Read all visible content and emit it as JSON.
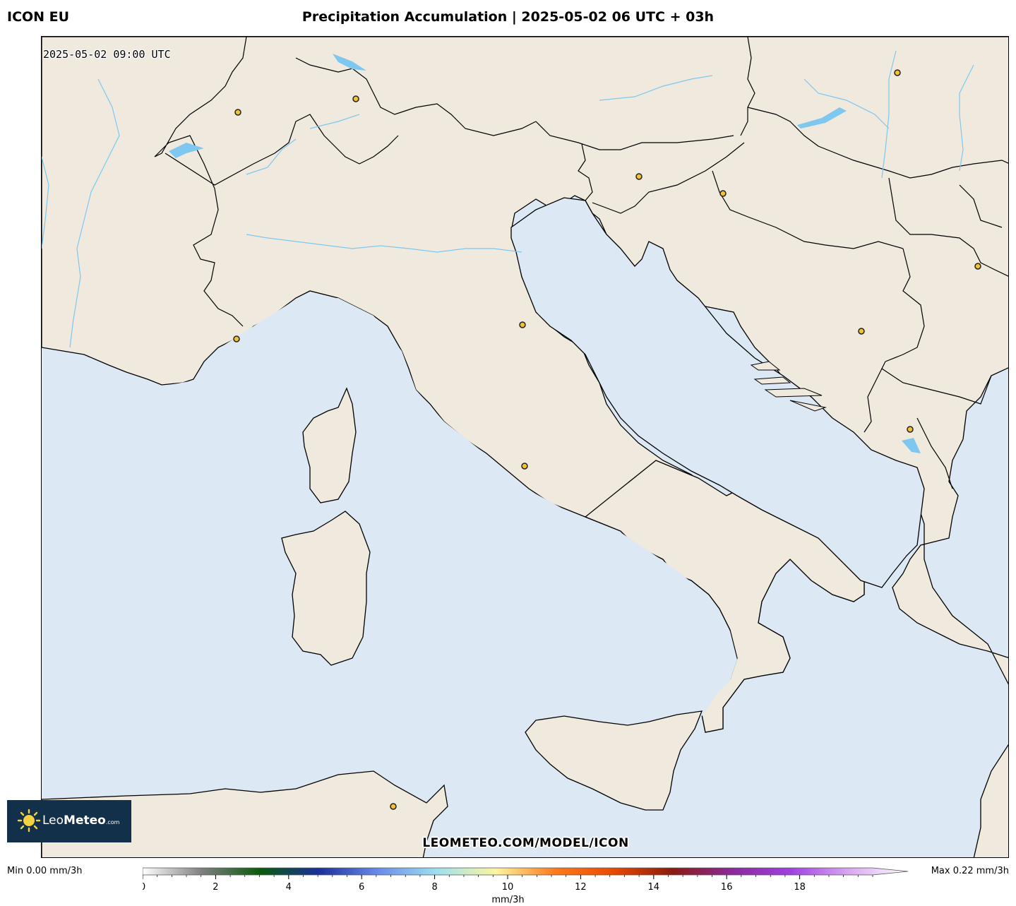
{
  "header": {
    "model": "ICON EU",
    "title": "Precipitation Accumulation | 2025-05-02 06 UTC + 03h"
  },
  "map": {
    "valid_time": "2025-05-02 09:00 UTC",
    "watermark": "LEOMETEO.COM/MODEL/ICON",
    "colors": {
      "sea": "#dce9f5",
      "land": "#efe9de",
      "border": "#000000",
      "water": "#7ec8f0",
      "marker": "#f2c230"
    }
  },
  "logo": {
    "brand_prefix": "Leo",
    "brand_main": "Meteo",
    "brand_suffix": ".com"
  },
  "colorbar": {
    "min_label": "Min 0.00 mm/3h",
    "max_label": "Max 0.22 mm/3h",
    "unit": "mm/3h",
    "ticks": [
      "0",
      "2",
      "4",
      "6",
      "8",
      "10",
      "12",
      "14",
      "16",
      "18"
    ],
    "range": [
      0,
      20
    ],
    "stops": [
      "#ffffff",
      "#808080",
      "#0a5a0a",
      "#1a2f9c",
      "#6a8ce8",
      "#9ee0f0",
      "#fbf6a0",
      "#ff7a1a",
      "#e84a00",
      "#8a1a10",
      "#8a2a9a",
      "#a040e0",
      "#d8a8f0",
      "#ffffff"
    ]
  }
}
